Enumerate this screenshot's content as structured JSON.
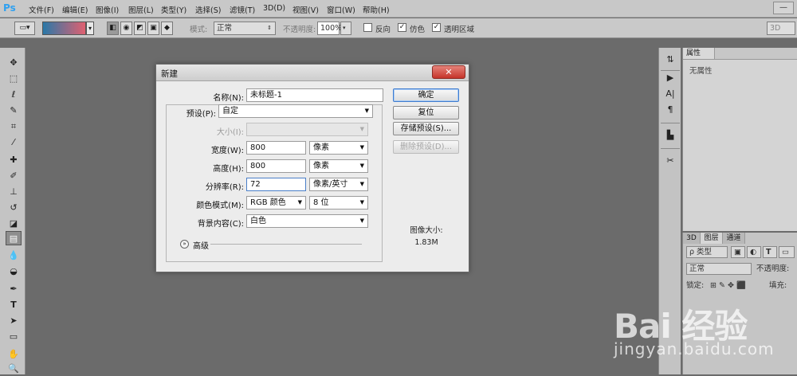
{
  "menubar": {
    "logo": "Ps",
    "items": [
      "文件(F)",
      "编辑(E)",
      "图像(I)",
      "图层(L)",
      "类型(Y)",
      "选择(S)",
      "滤镜(T)",
      "3D(D)",
      "视图(V)",
      "窗口(W)",
      "帮助(H)"
    ]
  },
  "options": {
    "mode_label": "模式:",
    "mode_value": "正常",
    "opacity_label": "不透明度:",
    "opacity_value": "100%",
    "reverse_label": "反向",
    "dither_label": "仿色",
    "transparency_label": "透明区域",
    "reverse_checked": false,
    "dither_checked": true,
    "transparency_checked": true,
    "workspace": "3D"
  },
  "properties": {
    "tab": "属性",
    "empty_text": "无属性"
  },
  "layers": {
    "tabs": [
      "3D",
      "图层",
      "通道"
    ],
    "filter": "ρ 类型",
    "blend": "正常",
    "opacity_label": "不透明度:",
    "lock_label": "锁定:",
    "fill_label": "填充:"
  },
  "dialog": {
    "title": "新建",
    "close": "✕",
    "name_label": "名称(N):",
    "name_value": "未标题-1",
    "preset_label": "预设(P):",
    "preset_value": "自定",
    "size_label": "大小(I):",
    "width_label": "宽度(W):",
    "width_value": "800",
    "width_unit": "像素",
    "height_label": "高度(H):",
    "height_value": "800",
    "height_unit": "像素",
    "res_label": "分辨率(R):",
    "res_value": "72",
    "res_unit": "像素/英寸",
    "color_label": "颜色模式(M):",
    "color_value": "RGB 颜色",
    "bits_value": "8 位",
    "bg_label": "背景内容(C):",
    "bg_value": "白色",
    "advanced": "高级",
    "ok": "确定",
    "reset": "复位",
    "save_preset": "存储预设(S)...",
    "delete_preset": "删除预设(D)...",
    "image_size_label": "图像大小:",
    "image_size_value": "1.83M"
  },
  "watermark": {
    "brand": "Bai 经验",
    "url": "jingyan.baidu.com"
  }
}
